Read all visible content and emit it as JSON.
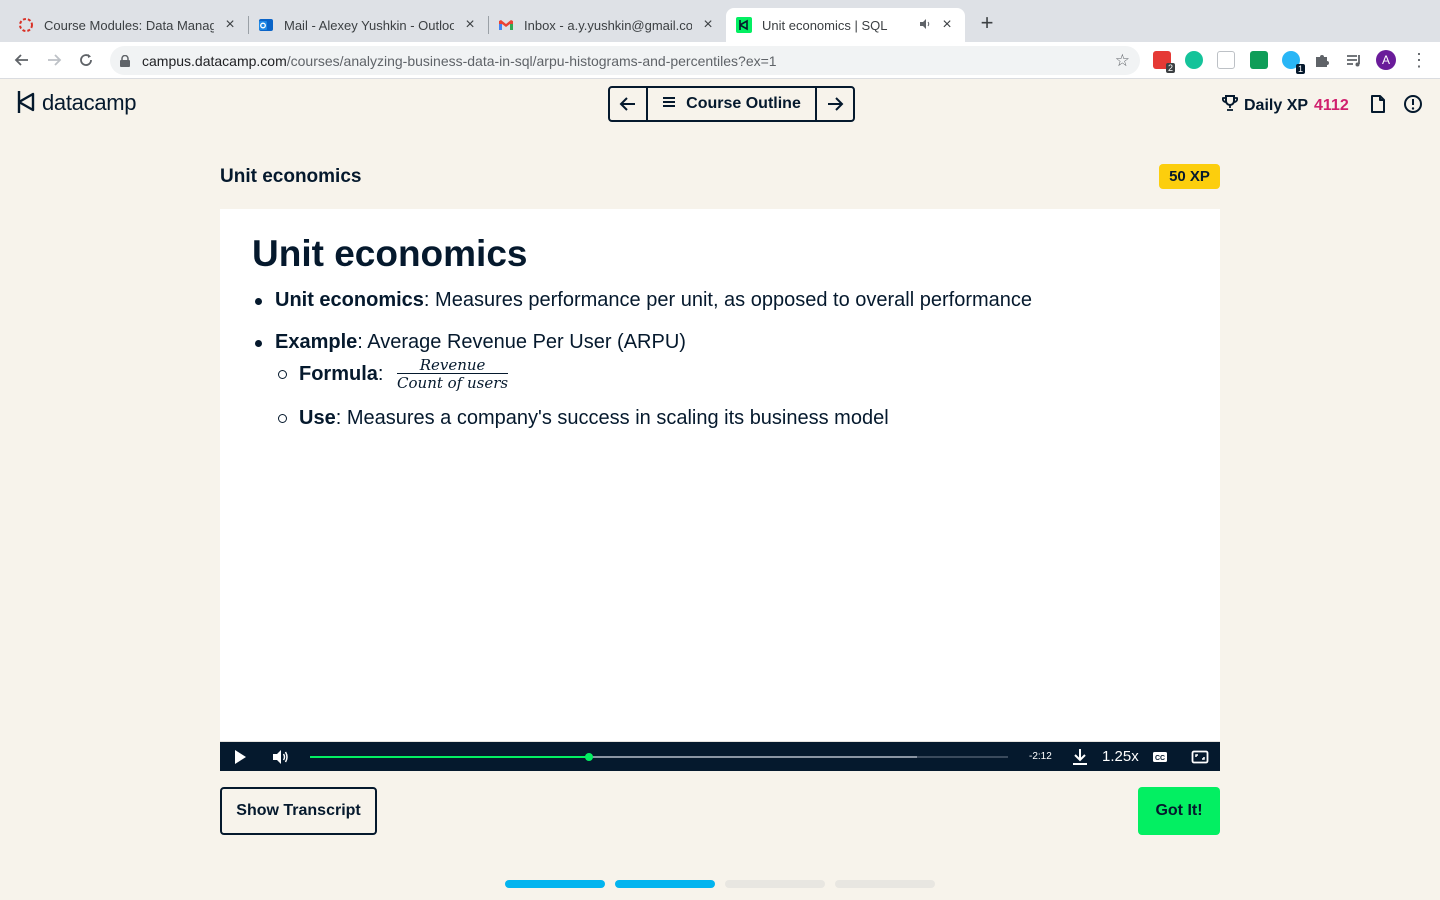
{
  "browser": {
    "tabs": [
      {
        "title": "Course Modules: Data Manage",
        "favicon": "lifebuoy-icon",
        "active": false
      },
      {
        "title": "Mail - Alexey Yushkin - Outlook",
        "favicon": "outlook-icon",
        "active": false
      },
      {
        "title": "Inbox - a.y.yushkin@gmail.com",
        "favicon": "gmail-icon",
        "active": false
      },
      {
        "title": "Unit economics | SQL",
        "favicon": "datacamp-icon",
        "active": true
      }
    ],
    "url_host": "campus.datacamp.com",
    "url_path": "/courses/analyzing-business-data-in-sql/arpu-histograms-and-percentiles?ex=1",
    "extension_badges": [
      "2",
      "1"
    ],
    "profile_initial": "A"
  },
  "header": {
    "logo_text": "datacamp",
    "course_outline_label": "Course Outline",
    "daily_xp_label": "Daily XP",
    "daily_xp_value": "4112"
  },
  "exercise": {
    "title": "Unit economics",
    "xp_badge": "50 XP"
  },
  "slide": {
    "heading": "Unit economics",
    "bullet1_bold": "Unit economics",
    "bullet1_text": ": Measures performance per unit, as opposed to overall performance",
    "bullet2_bold": "Example",
    "bullet2_text": ": Average Revenue Per User (ARPU)",
    "sub1_bold": "Formula",
    "sub1_sep": ":",
    "formula_numerator": "Revenue",
    "formula_denominator": "Count of users",
    "sub2_bold": "Use",
    "sub2_text": ": Measures a company's success in scaling its business model"
  },
  "player": {
    "progress": 0.4,
    "buffered": 0.87,
    "time_remaining": "-2:12",
    "speed": "1.25x"
  },
  "actions": {
    "transcript_label": "Show Transcript",
    "got_it_label": "Got It!"
  },
  "lesson_progress": {
    "segments": 4,
    "completed": 2,
    "active_color": "#03b4ef",
    "inactive_color": "#e8e6e1"
  },
  "colors": {
    "brand_green": "#03ef62",
    "navy": "#05192d",
    "xp_yellow": "#fcce0d",
    "xp_value": "#d0206e",
    "background": "#f7f3eb"
  }
}
